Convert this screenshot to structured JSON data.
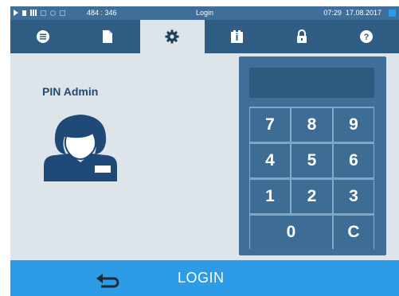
{
  "status_bar": {
    "coordinates": "484 : 346",
    "title": "Login",
    "time": "07:29",
    "date": "17.08.2017"
  },
  "tabs": [
    {
      "icon": "menu-icon",
      "active": false
    },
    {
      "icon": "document-icon",
      "active": false
    },
    {
      "icon": "gear-icon",
      "active": true
    },
    {
      "icon": "info-icon",
      "active": false
    },
    {
      "icon": "lock-icon",
      "active": false
    },
    {
      "icon": "help-icon",
      "active": false
    }
  ],
  "main": {
    "pin_label": "PIN Admin",
    "user_icon": "admin-user-icon"
  },
  "keypad": {
    "display_value": "",
    "keys": [
      "7",
      "8",
      "9",
      "4",
      "5",
      "6",
      "1",
      "2",
      "3",
      "0",
      "C"
    ]
  },
  "footer": {
    "back_icon": "back-arrow-icon",
    "login_label": "LOGIN"
  },
  "colors": {
    "status_bar": "#3f6f98",
    "tab_bar": "#2f5d83",
    "background": "#dde4ea",
    "footer": "#2e9be6",
    "keypad": "#3f6f98"
  }
}
